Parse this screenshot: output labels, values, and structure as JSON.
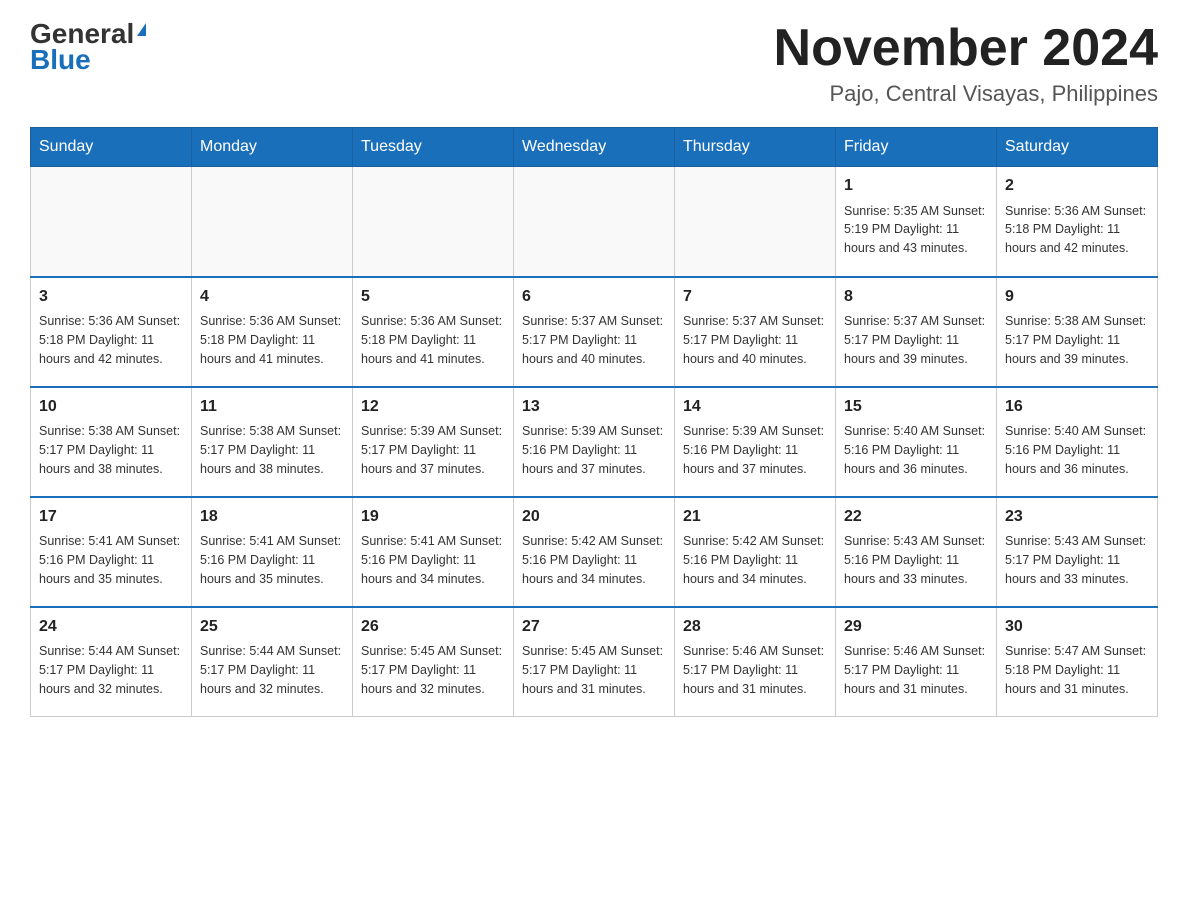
{
  "header": {
    "logo_general": "General",
    "logo_blue": "Blue",
    "title": "November 2024",
    "subtitle": "Pajo, Central Visayas, Philippines"
  },
  "days_of_week": [
    "Sunday",
    "Monday",
    "Tuesday",
    "Wednesday",
    "Thursday",
    "Friday",
    "Saturday"
  ],
  "weeks": [
    [
      {
        "day": "",
        "info": ""
      },
      {
        "day": "",
        "info": ""
      },
      {
        "day": "",
        "info": ""
      },
      {
        "day": "",
        "info": ""
      },
      {
        "day": "",
        "info": ""
      },
      {
        "day": "1",
        "info": "Sunrise: 5:35 AM\nSunset: 5:19 PM\nDaylight: 11 hours\nand 43 minutes."
      },
      {
        "day": "2",
        "info": "Sunrise: 5:36 AM\nSunset: 5:18 PM\nDaylight: 11 hours\nand 42 minutes."
      }
    ],
    [
      {
        "day": "3",
        "info": "Sunrise: 5:36 AM\nSunset: 5:18 PM\nDaylight: 11 hours\nand 42 minutes."
      },
      {
        "day": "4",
        "info": "Sunrise: 5:36 AM\nSunset: 5:18 PM\nDaylight: 11 hours\nand 41 minutes."
      },
      {
        "day": "5",
        "info": "Sunrise: 5:36 AM\nSunset: 5:18 PM\nDaylight: 11 hours\nand 41 minutes."
      },
      {
        "day": "6",
        "info": "Sunrise: 5:37 AM\nSunset: 5:17 PM\nDaylight: 11 hours\nand 40 minutes."
      },
      {
        "day": "7",
        "info": "Sunrise: 5:37 AM\nSunset: 5:17 PM\nDaylight: 11 hours\nand 40 minutes."
      },
      {
        "day": "8",
        "info": "Sunrise: 5:37 AM\nSunset: 5:17 PM\nDaylight: 11 hours\nand 39 minutes."
      },
      {
        "day": "9",
        "info": "Sunrise: 5:38 AM\nSunset: 5:17 PM\nDaylight: 11 hours\nand 39 minutes."
      }
    ],
    [
      {
        "day": "10",
        "info": "Sunrise: 5:38 AM\nSunset: 5:17 PM\nDaylight: 11 hours\nand 38 minutes."
      },
      {
        "day": "11",
        "info": "Sunrise: 5:38 AM\nSunset: 5:17 PM\nDaylight: 11 hours\nand 38 minutes."
      },
      {
        "day": "12",
        "info": "Sunrise: 5:39 AM\nSunset: 5:17 PM\nDaylight: 11 hours\nand 37 minutes."
      },
      {
        "day": "13",
        "info": "Sunrise: 5:39 AM\nSunset: 5:16 PM\nDaylight: 11 hours\nand 37 minutes."
      },
      {
        "day": "14",
        "info": "Sunrise: 5:39 AM\nSunset: 5:16 PM\nDaylight: 11 hours\nand 37 minutes."
      },
      {
        "day": "15",
        "info": "Sunrise: 5:40 AM\nSunset: 5:16 PM\nDaylight: 11 hours\nand 36 minutes."
      },
      {
        "day": "16",
        "info": "Sunrise: 5:40 AM\nSunset: 5:16 PM\nDaylight: 11 hours\nand 36 minutes."
      }
    ],
    [
      {
        "day": "17",
        "info": "Sunrise: 5:41 AM\nSunset: 5:16 PM\nDaylight: 11 hours\nand 35 minutes."
      },
      {
        "day": "18",
        "info": "Sunrise: 5:41 AM\nSunset: 5:16 PM\nDaylight: 11 hours\nand 35 minutes."
      },
      {
        "day": "19",
        "info": "Sunrise: 5:41 AM\nSunset: 5:16 PM\nDaylight: 11 hours\nand 34 minutes."
      },
      {
        "day": "20",
        "info": "Sunrise: 5:42 AM\nSunset: 5:16 PM\nDaylight: 11 hours\nand 34 minutes."
      },
      {
        "day": "21",
        "info": "Sunrise: 5:42 AM\nSunset: 5:16 PM\nDaylight: 11 hours\nand 34 minutes."
      },
      {
        "day": "22",
        "info": "Sunrise: 5:43 AM\nSunset: 5:16 PM\nDaylight: 11 hours\nand 33 minutes."
      },
      {
        "day": "23",
        "info": "Sunrise: 5:43 AM\nSunset: 5:17 PM\nDaylight: 11 hours\nand 33 minutes."
      }
    ],
    [
      {
        "day": "24",
        "info": "Sunrise: 5:44 AM\nSunset: 5:17 PM\nDaylight: 11 hours\nand 32 minutes."
      },
      {
        "day": "25",
        "info": "Sunrise: 5:44 AM\nSunset: 5:17 PM\nDaylight: 11 hours\nand 32 minutes."
      },
      {
        "day": "26",
        "info": "Sunrise: 5:45 AM\nSunset: 5:17 PM\nDaylight: 11 hours\nand 32 minutes."
      },
      {
        "day": "27",
        "info": "Sunrise: 5:45 AM\nSunset: 5:17 PM\nDaylight: 11 hours\nand 31 minutes."
      },
      {
        "day": "28",
        "info": "Sunrise: 5:46 AM\nSunset: 5:17 PM\nDaylight: 11 hours\nand 31 minutes."
      },
      {
        "day": "29",
        "info": "Sunrise: 5:46 AM\nSunset: 5:17 PM\nDaylight: 11 hours\nand 31 minutes."
      },
      {
        "day": "30",
        "info": "Sunrise: 5:47 AM\nSunset: 5:18 PM\nDaylight: 11 hours\nand 31 minutes."
      }
    ]
  ]
}
